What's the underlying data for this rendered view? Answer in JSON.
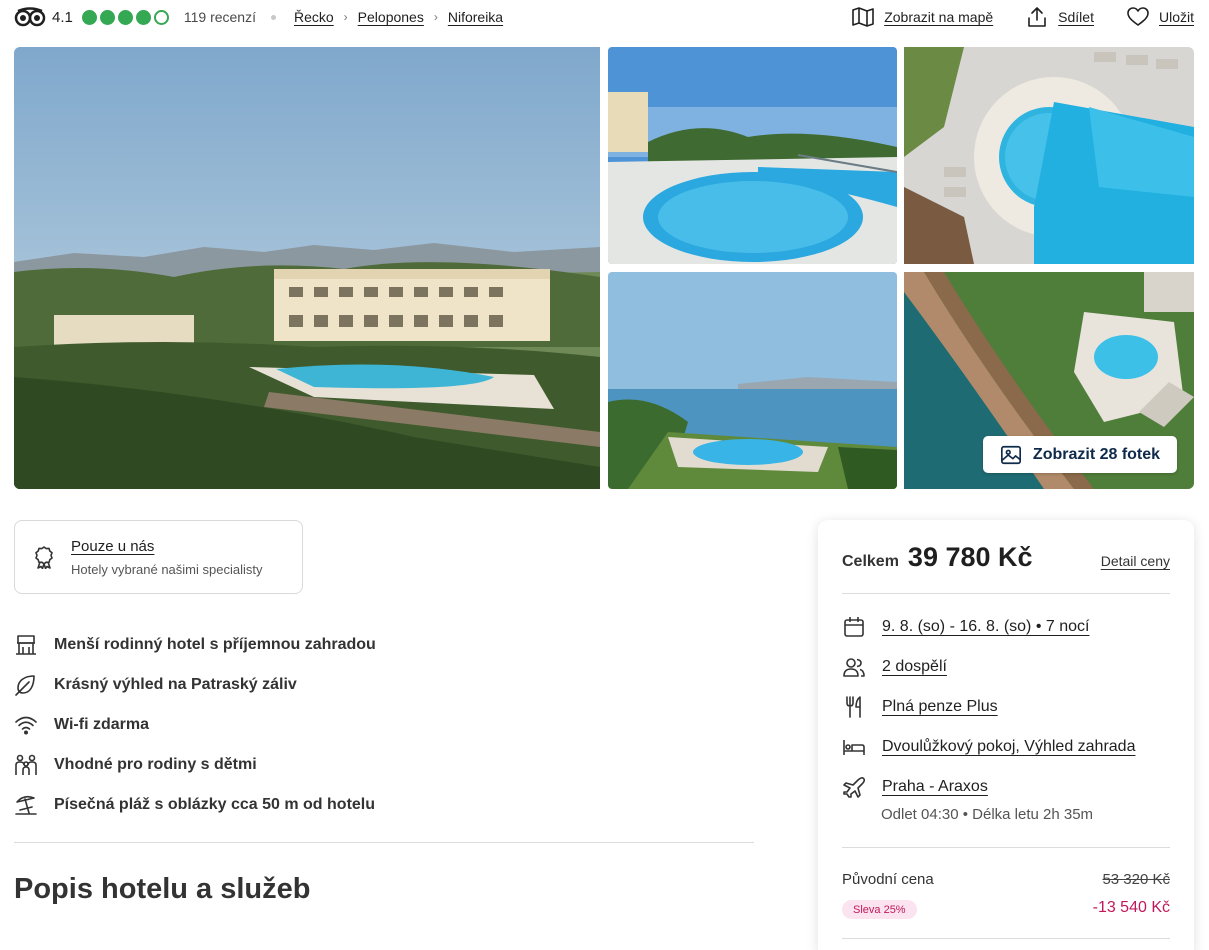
{
  "header": {
    "rating": "4.1",
    "rating_dots_filled": 4,
    "rating_dots_total": 5,
    "reviews": "119 recenzí",
    "breadcrumbs": [
      "Řecko",
      "Pelopones",
      "Niforeika"
    ],
    "actions": {
      "map": "Zobrazit na mapě",
      "share": "Sdílet",
      "save": "Uložit"
    }
  },
  "gallery": {
    "show_photos": "Zobrazit 28 fotek"
  },
  "exclusive": {
    "title": "Pouze u nás",
    "subtitle": "Hotely vybrané našimi specialisty"
  },
  "features": [
    {
      "icon": "hotel-icon",
      "text": "Menší rodinný hotel s příjemnou zahradou"
    },
    {
      "icon": "leaf-icon",
      "text": "Krásný výhled na Patraský záliv"
    },
    {
      "icon": "wifi-icon",
      "text": "Wi-fi zdarma"
    },
    {
      "icon": "family-icon",
      "text": "Vhodné pro rodiny s dětmi"
    },
    {
      "icon": "beach-icon",
      "text": "Písečná pláž s oblázky cca 50 m od hotelu"
    }
  ],
  "section_title": "Popis hotelu a služeb",
  "price_card": {
    "total_label": "Celkem",
    "total_value": "39 780 Kč",
    "detail_link": "Detail ceny",
    "dates": "9. 8. (so) - 16. 8. (so) • 7 nocí",
    "guests": "2 dospělí",
    "board": "Plná penze Plus",
    "room": "Dvoulůžkový pokoj, Výhled zahrada",
    "flight": "Praha - Araxos",
    "flight_detail": "Odlet 04:30 • Délka letu 2h 35m",
    "original_label": "Původní cena",
    "original_price": "53 320 Kč",
    "discount_badge": "Sleva 25%",
    "discount_amount": "-13 540 Kč"
  },
  "colors": {
    "rating_green": "#34a853",
    "discount_pink": "#c2185b",
    "button_text": "#0f2a4a"
  }
}
